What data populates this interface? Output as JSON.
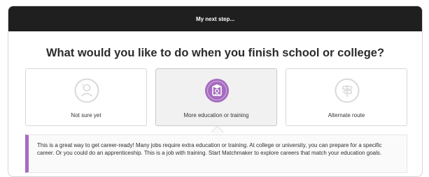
{
  "header": {
    "title": "My next step..."
  },
  "question": "What would you like to do when you finish school or college?",
  "options": [
    {
      "label": "Not sure yet",
      "icon": "person-question-icon",
      "selected": false
    },
    {
      "label": "More education or training",
      "icon": "graduate-icon",
      "selected": true
    },
    {
      "label": "Alternate route",
      "icon": "signpost-icon",
      "selected": false
    }
  ],
  "info": {
    "text": "This is a great way to get career-ready! Many jobs require extra education or training. At college or university, you can prepare for a specific career. Or you could do an apprenticeship. This is a job with training. Start Matchmaker to explore careers that match your education goals."
  },
  "colors": {
    "header_bg": "#1f1f1f",
    "accent": "#a66bc0",
    "icon_inactive": "#d9d9d9"
  }
}
